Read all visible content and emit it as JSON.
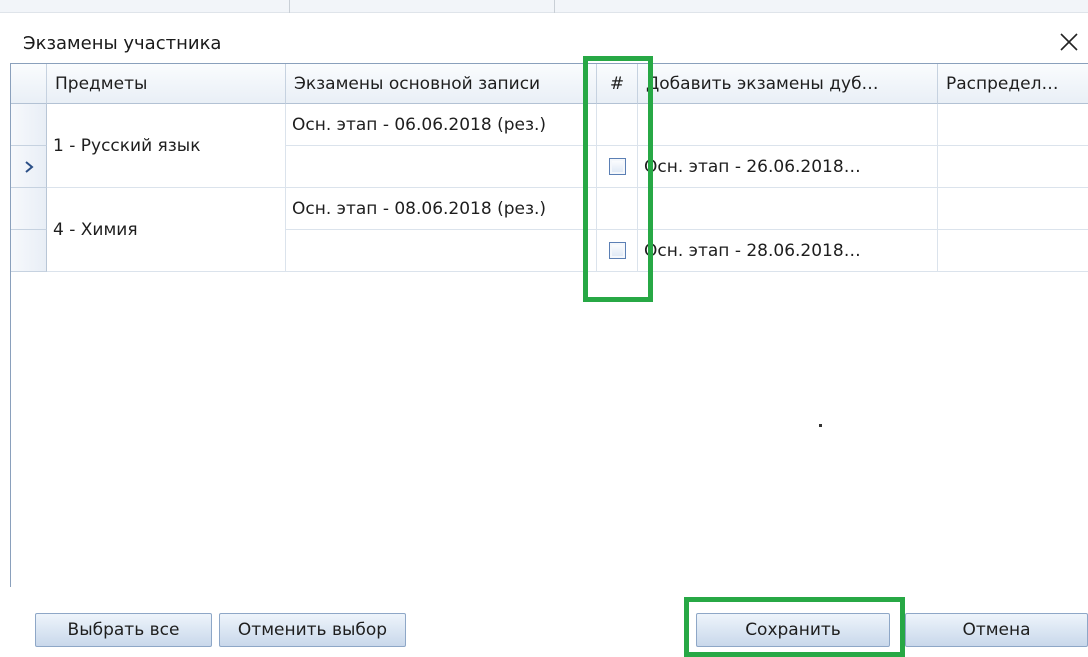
{
  "dialog": {
    "title": "Экзамены участника"
  },
  "grid": {
    "columns": [
      "Предметы",
      "Экзамены основной записи",
      "#",
      "Добавить экзамены дуб…",
      "Распредел…"
    ],
    "subjects": [
      {
        "name": "1 - Русский язык",
        "main_exam": "Осн. этап - 06.06.2018 (рез.)",
        "add_duplicate": "Осн. этап - 26.06.2018…",
        "checked": false
      },
      {
        "name": "4 - Химия",
        "main_exam": "Осн. этап - 08.06.2018 (рез.)",
        "add_duplicate": "Осн. этап - 28.06.2018…",
        "checked": false
      }
    ]
  },
  "buttons": {
    "select_all": "Выбрать все",
    "clear_selection": "Отменить выбор",
    "save": "Сохранить",
    "cancel": "Отмена"
  },
  "colors": {
    "highlight": "#27a845",
    "grid_border": "#8aa0bc",
    "button_border": "#8ea7c7"
  }
}
